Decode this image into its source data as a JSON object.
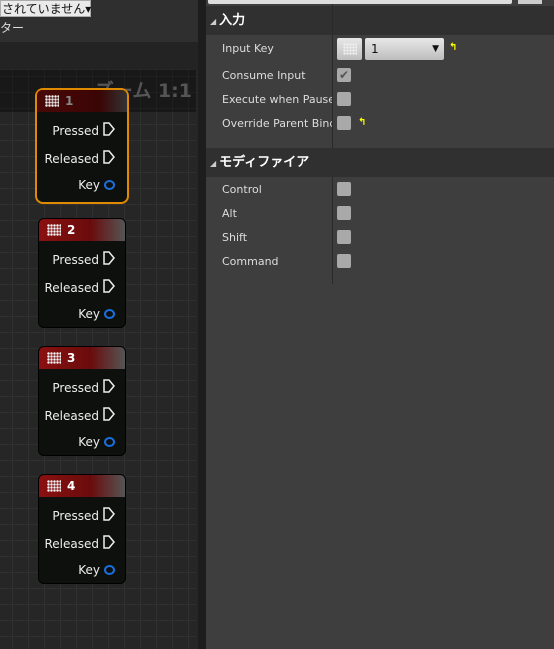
{
  "graph": {
    "dropdown_text": "されていません",
    "filter_label": "ター",
    "zoom_label": "ズーム 1:1",
    "nodes": [
      {
        "title": "1",
        "selected": true,
        "pins": {
          "pressed": "Pressed",
          "released": "Released",
          "key": "Key"
        }
      },
      {
        "title": "2",
        "selected": false,
        "pins": {
          "pressed": "Pressed",
          "released": "Released",
          "key": "Key"
        }
      },
      {
        "title": "3",
        "selected": false,
        "pins": {
          "pressed": "Pressed",
          "released": "Released",
          "key": "Key"
        }
      },
      {
        "title": "4",
        "selected": false,
        "pins": {
          "pressed": "Pressed",
          "released": "Released",
          "key": "Key"
        }
      }
    ],
    "colors": {
      "node_header": "#8a1010",
      "selection": "#e08a00",
      "key_pin": "#1a6fe0"
    }
  },
  "details": {
    "input": {
      "header": "入力",
      "input_key_label": "Input Key",
      "input_key_value": "1",
      "consume_input_label": "Consume Input",
      "consume_input": true,
      "execute_paused_label": "Execute when Paused",
      "execute_paused": false,
      "override_label": "Override Parent Bindir",
      "override": false
    },
    "modifier": {
      "header": "モディファイア",
      "items": [
        {
          "label": "Control",
          "checked": false
        },
        {
          "label": "Alt",
          "checked": false
        },
        {
          "label": "Shift",
          "checked": false
        },
        {
          "label": "Command",
          "checked": false
        }
      ]
    }
  }
}
